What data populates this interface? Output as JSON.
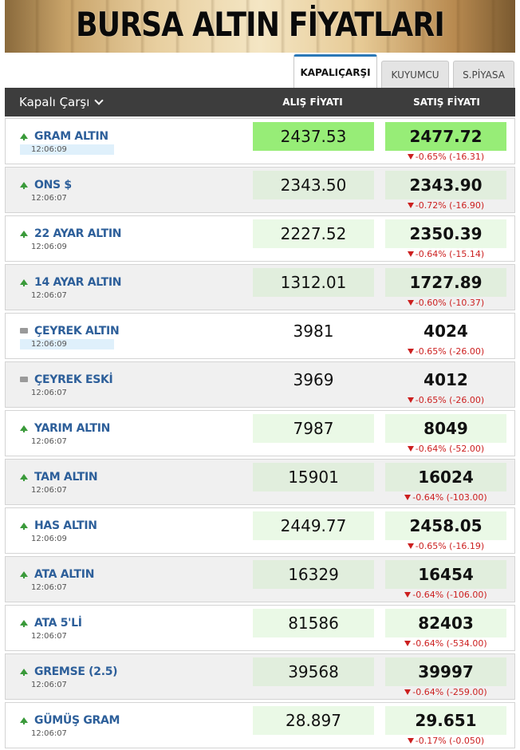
{
  "banner": {
    "title": "BURSA ALTIN FİYATLARI"
  },
  "tabs": [
    {
      "label": "KAPALIÇARŞI",
      "active": true
    },
    {
      "label": "KUYUMCU",
      "active": false
    },
    {
      "label": "S.PİYASA",
      "active": false
    }
  ],
  "header": {
    "market": "Kapalı Çarşı",
    "buy_label": "ALIŞ FİYATI",
    "sell_label": "SATIŞ FİYATI"
  },
  "colors": {
    "header_bg": "#3d3d3d",
    "name_text": "#2d5f9a",
    "up_arrow": "#3a9a3a",
    "change_down": "#cc1f1f",
    "highlight_strong": "#97ed77",
    "highlight_mid": "#e1eedd",
    "highlight_light": "#eaf9e6",
    "tab_active_border": "#2b78b7"
  },
  "rows": [
    {
      "name": "GRAM ALTIN",
      "icon": "up-arrow-icon",
      "time": "12:06:09",
      "buy": "2437.53",
      "sell": "2477.72",
      "change": "-0.65% (-16.31)"
    },
    {
      "name": "ONS $",
      "icon": "up-arrow-icon",
      "time": "12:06:07",
      "buy": "2343.50",
      "sell": "2343.90",
      "change": "-0.72% (-16.90)"
    },
    {
      "name": "22 AYAR ALTIN",
      "icon": "up-arrow-icon",
      "time": "12:06:09",
      "buy": "2227.52",
      "sell": "2350.39",
      "change": "-0.64% (-15.14)"
    },
    {
      "name": "14 AYAR ALTIN",
      "icon": "up-arrow-icon",
      "time": "12:06:07",
      "buy": "1312.01",
      "sell": "1727.89",
      "change": "-0.60% (-10.37)"
    },
    {
      "name": "ÇEYREK ALTIN",
      "icon": "flat-icon",
      "time": "12:06:09",
      "buy": "3981",
      "sell": "4024",
      "change": "-0.65% (-26.00)"
    },
    {
      "name": "ÇEYREK ESKİ",
      "icon": "flat-icon",
      "time": "12:06:07",
      "buy": "3969",
      "sell": "4012",
      "change": "-0.65% (-26.00)"
    },
    {
      "name": "YARIM ALTIN",
      "icon": "up-arrow-icon",
      "time": "12:06:07",
      "buy": "7987",
      "sell": "8049",
      "change": "-0.64% (-52.00)"
    },
    {
      "name": "TAM ALTIN",
      "icon": "up-arrow-icon",
      "time": "12:06:07",
      "buy": "15901",
      "sell": "16024",
      "change": "-0.64% (-103.00)"
    },
    {
      "name": "HAS ALTIN",
      "icon": "up-arrow-icon",
      "time": "12:06:09",
      "buy": "2449.77",
      "sell": "2458.05",
      "change": "-0.65% (-16.19)"
    },
    {
      "name": "ATA ALTIN",
      "icon": "up-arrow-icon",
      "time": "12:06:07",
      "buy": "16329",
      "sell": "16454",
      "change": "-0.64% (-106.00)"
    },
    {
      "name": "ATA 5'Lİ",
      "icon": "up-arrow-icon",
      "time": "12:06:07",
      "buy": "81586",
      "sell": "82403",
      "change": "-0.64% (-534.00)"
    },
    {
      "name": "GREMSE (2.5)",
      "icon": "up-arrow-icon",
      "time": "12:06:07",
      "buy": "39568",
      "sell": "39997",
      "change": "-0.64% (-259.00)"
    },
    {
      "name": "GÜMÜŞ GRAM",
      "icon": "up-arrow-icon",
      "time": "12:06:07",
      "buy": "28.897",
      "sell": "29.651",
      "change": "-0.17% (-0.050)"
    }
  ]
}
